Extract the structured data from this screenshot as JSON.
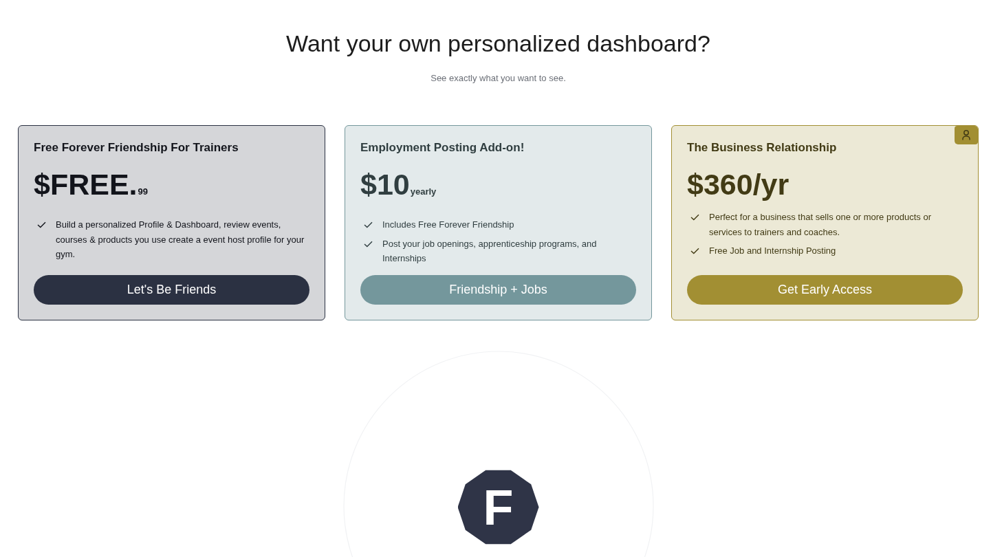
{
  "header": {
    "title": "Want your own personalized dashboard?",
    "subtitle": "See exactly what you want to see."
  },
  "plans": [
    {
      "title": "Free Forever Friendship For Trainers",
      "price": "$FREE.",
      "period": "99",
      "color": "#2b3142",
      "badge": false,
      "features": [
        "Build a personalized Profile & Dashboard, review events, courses & products you use create a event host profile for your gym."
      ],
      "button": "Let's Be Friends"
    },
    {
      "title": "Employment Posting Add-on!",
      "price": "$10",
      "period": "yearly",
      "color": "#74979c",
      "badge": false,
      "features": [
        "Includes Free Forever Friendship",
        "Post your job openings, apprenticeship programs, and Internships"
      ],
      "button": "Friendship + Jobs"
    },
    {
      "title": "The Business Relationship",
      "price": "$360/yr",
      "color": "#a28f33",
      "badge": true,
      "features": [
        "Perfect for a business that sells one or more products or services to trainers and coaches.",
        "Free Job and Internship Posting"
      ],
      "button": "Get Early Access"
    }
  ],
  "logo": {
    "letter": "F"
  }
}
